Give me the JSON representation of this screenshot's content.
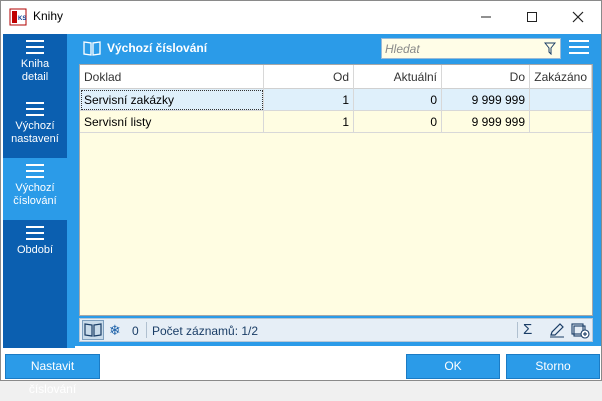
{
  "window": {
    "title": "Knihy"
  },
  "sidebar": {
    "items": [
      {
        "label_line1": "Kniha",
        "label_line2": "detail"
      },
      {
        "label_line1": "Výchozí",
        "label_line2": "nastavení"
      },
      {
        "label_line1": "Výchozí",
        "label_line2": "číslování"
      },
      {
        "label_line1": "Období",
        "label_line2": ""
      }
    ]
  },
  "panel": {
    "title": "Výchozí číslování",
    "search_placeholder": "Hledat"
  },
  "table": {
    "columns": [
      "Doklad",
      "Od",
      "Aktuální",
      "Do",
      "Zakázáno"
    ],
    "rows": [
      [
        "Servisní zakázky",
        "1",
        "0",
        "9 999 999",
        ""
      ],
      [
        "Servisní listy",
        "1",
        "0",
        "9 999 999",
        ""
      ]
    ]
  },
  "statusbar": {
    "zero": "0",
    "record_count": "Počet záznamů: 1/2",
    "sum_symbol": "Σ",
    "snow_symbol": "❄"
  },
  "buttons": {
    "numbering": "Nastavit číslování",
    "ok": "OK",
    "storno": "Storno"
  },
  "colors": {
    "accent": "#2b9be8",
    "sidebar": "#0b5fb0",
    "grid_bg": "#fffde2",
    "selected_row": "#dff0fb"
  }
}
